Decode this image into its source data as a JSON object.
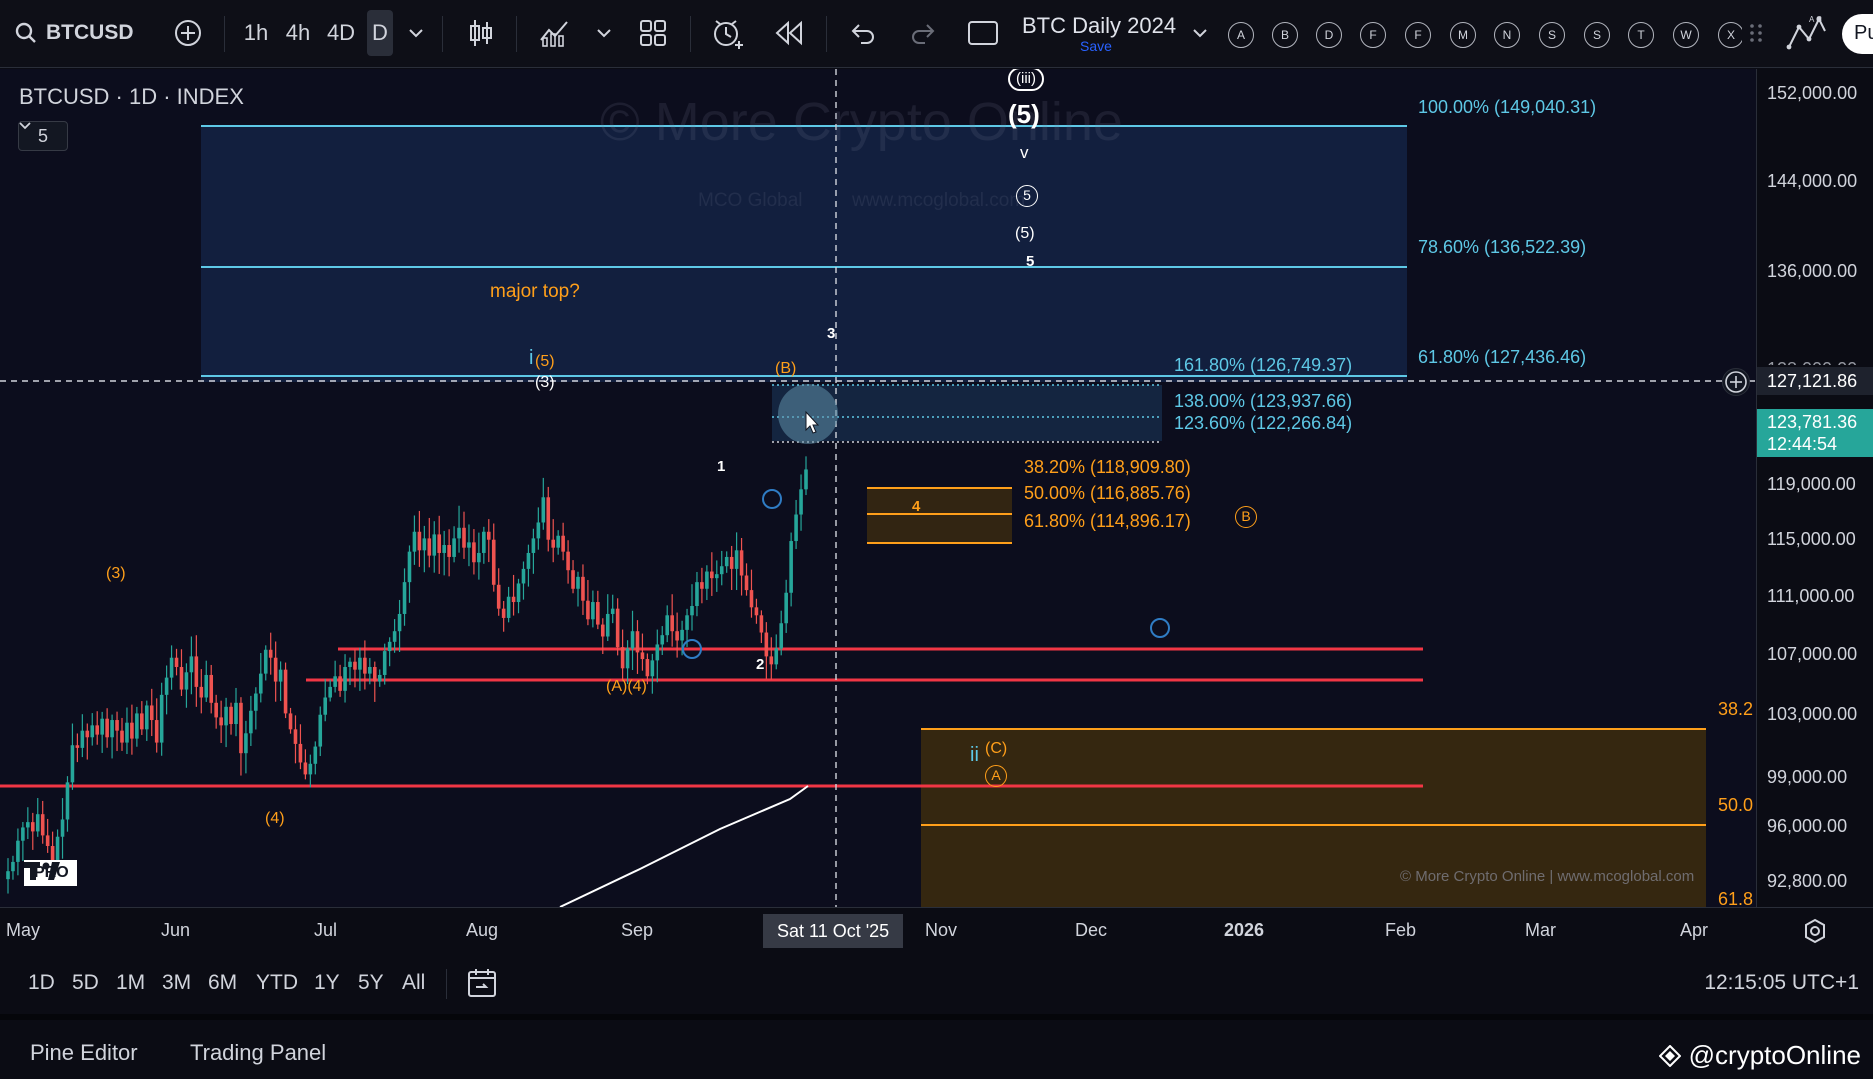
{
  "toolbar": {
    "symbol": "BTCUSD",
    "intervals": [
      "1h",
      "4h",
      "4D",
      "D"
    ],
    "active_interval": "D",
    "layout_title": "BTC Daily 2024",
    "layout_save": "Save",
    "alert_letters": [
      "A",
      "B",
      "D",
      "F",
      "F",
      "M",
      "N",
      "S",
      "S",
      "T",
      "W",
      "X"
    ],
    "right_cut": "Pu"
  },
  "chart": {
    "legend_title": "BTCUSD · 1D · INDEX",
    "legend_count": "5",
    "watermark_main": "© More Crypto Online",
    "watermark_sub1": "MCO Global",
    "watermark_sub2": "www.mcoglobal.com",
    "credit": "© More Crypto Online  |  www.mcoglobal.com",
    "fib_labels": {
      "f100": "100.00% (149,040.31)",
      "f786": "78.60% (136,522.39)",
      "f618_top": "61.80% (127,436.46)",
      "f1618": "161.80% (126,749.37)",
      "f138": "138.00% (123,937.66)",
      "f1236": "123.60% (122,266.84)",
      "f382": "38.20% (118,909.80)",
      "f50": "50.00% (116,885.76)",
      "f618": "61.80% (114,896.17)",
      "edge_382": "38.2",
      "edge_50": "50.0",
      "edge_618": "61.8"
    },
    "annotations": {
      "major_top": "major top?",
      "w_iii": "(iii)",
      "w_5_big": "(5)",
      "w_v": "v",
      "w_5_circle": "5",
      "w_5_paren": "(5)",
      "w_5_small": "5",
      "w_3": "3",
      "w_i": "i",
      "w_i5": "(5)",
      "w_i3": "(3)",
      "w_B_paren": "(B)",
      "w_1": "1",
      "w_4": "4",
      "w_B_circle": "B",
      "w_3_left": "(3)",
      "w_2": "2",
      "w_A4": "(A)(4)",
      "w_ii": "ii",
      "w_C": "(C)",
      "w_A_circle": "A",
      "w_4_left": "(4)"
    },
    "logo_text": "PRO"
  },
  "price_axis": {
    "ticks": [
      "152,000.00",
      "144,000.00",
      "136,000.00",
      "119,000.00",
      "115,000.00",
      "111,000.00",
      "107,000.00",
      "103,000.00",
      "99,000.00",
      "96,000.00",
      "92,800.00"
    ],
    "crosshair_price": "127,121.86",
    "last_price": "123,781.36",
    "countdown": "12:44:54",
    "hidden_tick": "128,000.00"
  },
  "time_axis": {
    "ticks": [
      "May",
      "Jun",
      "Jul",
      "Aug",
      "Sep",
      "Nov",
      "Dec",
      "2026",
      "Feb",
      "Mar",
      "Apr"
    ],
    "crosshair_date": "Sat 11 Oct '25"
  },
  "ranges": {
    "items": [
      "1D",
      "5D",
      "1M",
      "3M",
      "6M",
      "YTD",
      "1Y",
      "5Y",
      "All"
    ],
    "clock": "12:15:05 UTC+1"
  },
  "bottom": {
    "tabs": [
      "Pine Editor",
      "Trading Panel"
    ],
    "brand": "@cryptoOnline"
  },
  "colors": {
    "background": "#0c0d1d",
    "fib_blue": "#5ec8e6",
    "fib_orange": "#ff9f1a",
    "support_red": "#f23645",
    "candle_up": "#26a69a",
    "candle_down": "#ef5350"
  },
  "chart_data": {
    "type": "candlestick",
    "symbol": "BTCUSD",
    "interval": "1D",
    "closes": [
      93500,
      94200,
      95800,
      96800,
      97200,
      96500,
      97800,
      96200,
      95400,
      94300,
      96100,
      97400,
      100200,
      103000,
      102800,
      104100,
      103600,
      104500,
      103800,
      105000,
      103600,
      104900,
      104100,
      103200,
      104700,
      103500,
      105400,
      104200,
      106000,
      104900,
      103200,
      106800,
      108100,
      109600,
      108900,
      107200,
      108500,
      109700,
      107400,
      106600,
      108300,
      106200,
      105100,
      104500,
      105900,
      104600,
      106200,
      102400,
      103900,
      105600,
      106900,
      108400,
      110200,
      109600,
      107800,
      108700,
      105400,
      104200,
      103100,
      101700,
      100800,
      101600,
      102900,
      105300,
      106600,
      107400,
      108200,
      107100,
      108900,
      109300,
      108700,
      109600,
      108400,
      108900,
      107800,
      108300,
      110100,
      110800,
      111600,
      112900,
      115300,
      117600,
      119100,
      117700,
      118600,
      117300,
      118900,
      117500,
      118100,
      117200,
      118600,
      119400,
      117900,
      118300,
      116800,
      117500,
      119100,
      118500,
      115100,
      113300,
      112600,
      114200,
      113800,
      115200,
      116300,
      117500,
      118600,
      119800,
      121700,
      118500,
      117900,
      118800,
      117600,
      116200,
      114800,
      115700,
      113900,
      112500,
      113800,
      112100,
      111200,
      112900,
      113300,
      110400,
      108800,
      110300,
      111600,
      110000,
      109500,
      108200,
      109400,
      110600,
      111300,
      112800,
      111600,
      110900,
      111700,
      112800,
      113500,
      115300,
      114800,
      116100,
      115600,
      115900,
      116500,
      117200,
      116300,
      117700,
      115800,
      114700,
      113400,
      112800,
      111500,
      109700,
      109100,
      110300,
      112200,
      114500,
      118400,
      120400,
      122300,
      123800
    ],
    "fib_levels": [
      {
        "label": "100.00%",
        "value": 149040.31
      },
      {
        "label": "78.60%",
        "value": 136522.39
      },
      {
        "label": "61.80%",
        "value": 127436.46
      },
      {
        "label": "161.80%",
        "value": 126749.37
      },
      {
        "label": "138.00%",
        "value": 123937.66
      },
      {
        "label": "123.60%",
        "value": 122266.84
      },
      {
        "label": "38.20%",
        "value": 118909.8
      },
      {
        "label": "50.00%",
        "value": 116885.76
      },
      {
        "label": "61.80%",
        "value": 114896.17
      }
    ],
    "support_lines": [
      107000,
      105300,
      99000
    ],
    "ylim": [
      90800,
      154000
    ],
    "last_price": 123781.36,
    "crosshair_price": 127121.86
  }
}
